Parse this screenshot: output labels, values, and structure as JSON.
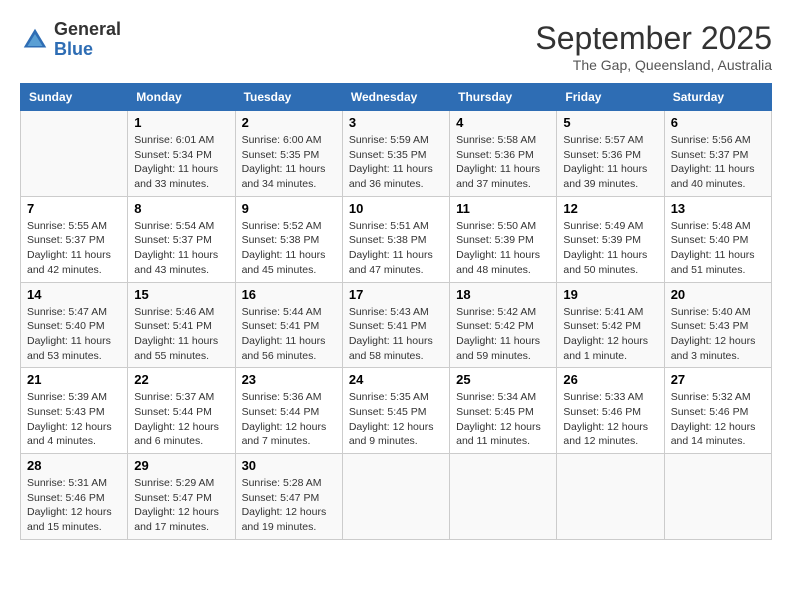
{
  "header": {
    "logo_general": "General",
    "logo_blue": "Blue",
    "month_year": "September 2025",
    "location": "The Gap, Queensland, Australia"
  },
  "days_of_week": [
    "Sunday",
    "Monday",
    "Tuesday",
    "Wednesday",
    "Thursday",
    "Friday",
    "Saturday"
  ],
  "weeks": [
    [
      {
        "day": "",
        "sunrise": "",
        "sunset": "",
        "daylight": ""
      },
      {
        "day": "1",
        "sunrise": "Sunrise: 6:01 AM",
        "sunset": "Sunset: 5:34 PM",
        "daylight": "Daylight: 11 hours and 33 minutes."
      },
      {
        "day": "2",
        "sunrise": "Sunrise: 6:00 AM",
        "sunset": "Sunset: 5:35 PM",
        "daylight": "Daylight: 11 hours and 34 minutes."
      },
      {
        "day": "3",
        "sunrise": "Sunrise: 5:59 AM",
        "sunset": "Sunset: 5:35 PM",
        "daylight": "Daylight: 11 hours and 36 minutes."
      },
      {
        "day": "4",
        "sunrise": "Sunrise: 5:58 AM",
        "sunset": "Sunset: 5:36 PM",
        "daylight": "Daylight: 11 hours and 37 minutes."
      },
      {
        "day": "5",
        "sunrise": "Sunrise: 5:57 AM",
        "sunset": "Sunset: 5:36 PM",
        "daylight": "Daylight: 11 hours and 39 minutes."
      },
      {
        "day": "6",
        "sunrise": "Sunrise: 5:56 AM",
        "sunset": "Sunset: 5:37 PM",
        "daylight": "Daylight: 11 hours and 40 minutes."
      }
    ],
    [
      {
        "day": "7",
        "sunrise": "Sunrise: 5:55 AM",
        "sunset": "Sunset: 5:37 PM",
        "daylight": "Daylight: 11 hours and 42 minutes."
      },
      {
        "day": "8",
        "sunrise": "Sunrise: 5:54 AM",
        "sunset": "Sunset: 5:37 PM",
        "daylight": "Daylight: 11 hours and 43 minutes."
      },
      {
        "day": "9",
        "sunrise": "Sunrise: 5:52 AM",
        "sunset": "Sunset: 5:38 PM",
        "daylight": "Daylight: 11 hours and 45 minutes."
      },
      {
        "day": "10",
        "sunrise": "Sunrise: 5:51 AM",
        "sunset": "Sunset: 5:38 PM",
        "daylight": "Daylight: 11 hours and 47 minutes."
      },
      {
        "day": "11",
        "sunrise": "Sunrise: 5:50 AM",
        "sunset": "Sunset: 5:39 PM",
        "daylight": "Daylight: 11 hours and 48 minutes."
      },
      {
        "day": "12",
        "sunrise": "Sunrise: 5:49 AM",
        "sunset": "Sunset: 5:39 PM",
        "daylight": "Daylight: 11 hours and 50 minutes."
      },
      {
        "day": "13",
        "sunrise": "Sunrise: 5:48 AM",
        "sunset": "Sunset: 5:40 PM",
        "daylight": "Daylight: 11 hours and 51 minutes."
      }
    ],
    [
      {
        "day": "14",
        "sunrise": "Sunrise: 5:47 AM",
        "sunset": "Sunset: 5:40 PM",
        "daylight": "Daylight: 11 hours and 53 minutes."
      },
      {
        "day": "15",
        "sunrise": "Sunrise: 5:46 AM",
        "sunset": "Sunset: 5:41 PM",
        "daylight": "Daylight: 11 hours and 55 minutes."
      },
      {
        "day": "16",
        "sunrise": "Sunrise: 5:44 AM",
        "sunset": "Sunset: 5:41 PM",
        "daylight": "Daylight: 11 hours and 56 minutes."
      },
      {
        "day": "17",
        "sunrise": "Sunrise: 5:43 AM",
        "sunset": "Sunset: 5:41 PM",
        "daylight": "Daylight: 11 hours and 58 minutes."
      },
      {
        "day": "18",
        "sunrise": "Sunrise: 5:42 AM",
        "sunset": "Sunset: 5:42 PM",
        "daylight": "Daylight: 11 hours and 59 minutes."
      },
      {
        "day": "19",
        "sunrise": "Sunrise: 5:41 AM",
        "sunset": "Sunset: 5:42 PM",
        "daylight": "Daylight: 12 hours and 1 minute."
      },
      {
        "day": "20",
        "sunrise": "Sunrise: 5:40 AM",
        "sunset": "Sunset: 5:43 PM",
        "daylight": "Daylight: 12 hours and 3 minutes."
      }
    ],
    [
      {
        "day": "21",
        "sunrise": "Sunrise: 5:39 AM",
        "sunset": "Sunset: 5:43 PM",
        "daylight": "Daylight: 12 hours and 4 minutes."
      },
      {
        "day": "22",
        "sunrise": "Sunrise: 5:37 AM",
        "sunset": "Sunset: 5:44 PM",
        "daylight": "Daylight: 12 hours and 6 minutes."
      },
      {
        "day": "23",
        "sunrise": "Sunrise: 5:36 AM",
        "sunset": "Sunset: 5:44 PM",
        "daylight": "Daylight: 12 hours and 7 minutes."
      },
      {
        "day": "24",
        "sunrise": "Sunrise: 5:35 AM",
        "sunset": "Sunset: 5:45 PM",
        "daylight": "Daylight: 12 hours and 9 minutes."
      },
      {
        "day": "25",
        "sunrise": "Sunrise: 5:34 AM",
        "sunset": "Sunset: 5:45 PM",
        "daylight": "Daylight: 12 hours and 11 minutes."
      },
      {
        "day": "26",
        "sunrise": "Sunrise: 5:33 AM",
        "sunset": "Sunset: 5:46 PM",
        "daylight": "Daylight: 12 hours and 12 minutes."
      },
      {
        "day": "27",
        "sunrise": "Sunrise: 5:32 AM",
        "sunset": "Sunset: 5:46 PM",
        "daylight": "Daylight: 12 hours and 14 minutes."
      }
    ],
    [
      {
        "day": "28",
        "sunrise": "Sunrise: 5:31 AM",
        "sunset": "Sunset: 5:46 PM",
        "daylight": "Daylight: 12 hours and 15 minutes."
      },
      {
        "day": "29",
        "sunrise": "Sunrise: 5:29 AM",
        "sunset": "Sunset: 5:47 PM",
        "daylight": "Daylight: 12 hours and 17 minutes."
      },
      {
        "day": "30",
        "sunrise": "Sunrise: 5:28 AM",
        "sunset": "Sunset: 5:47 PM",
        "daylight": "Daylight: 12 hours and 19 minutes."
      },
      {
        "day": "",
        "sunrise": "",
        "sunset": "",
        "daylight": ""
      },
      {
        "day": "",
        "sunrise": "",
        "sunset": "",
        "daylight": ""
      },
      {
        "day": "",
        "sunrise": "",
        "sunset": "",
        "daylight": ""
      },
      {
        "day": "",
        "sunrise": "",
        "sunset": "",
        "daylight": ""
      }
    ]
  ]
}
